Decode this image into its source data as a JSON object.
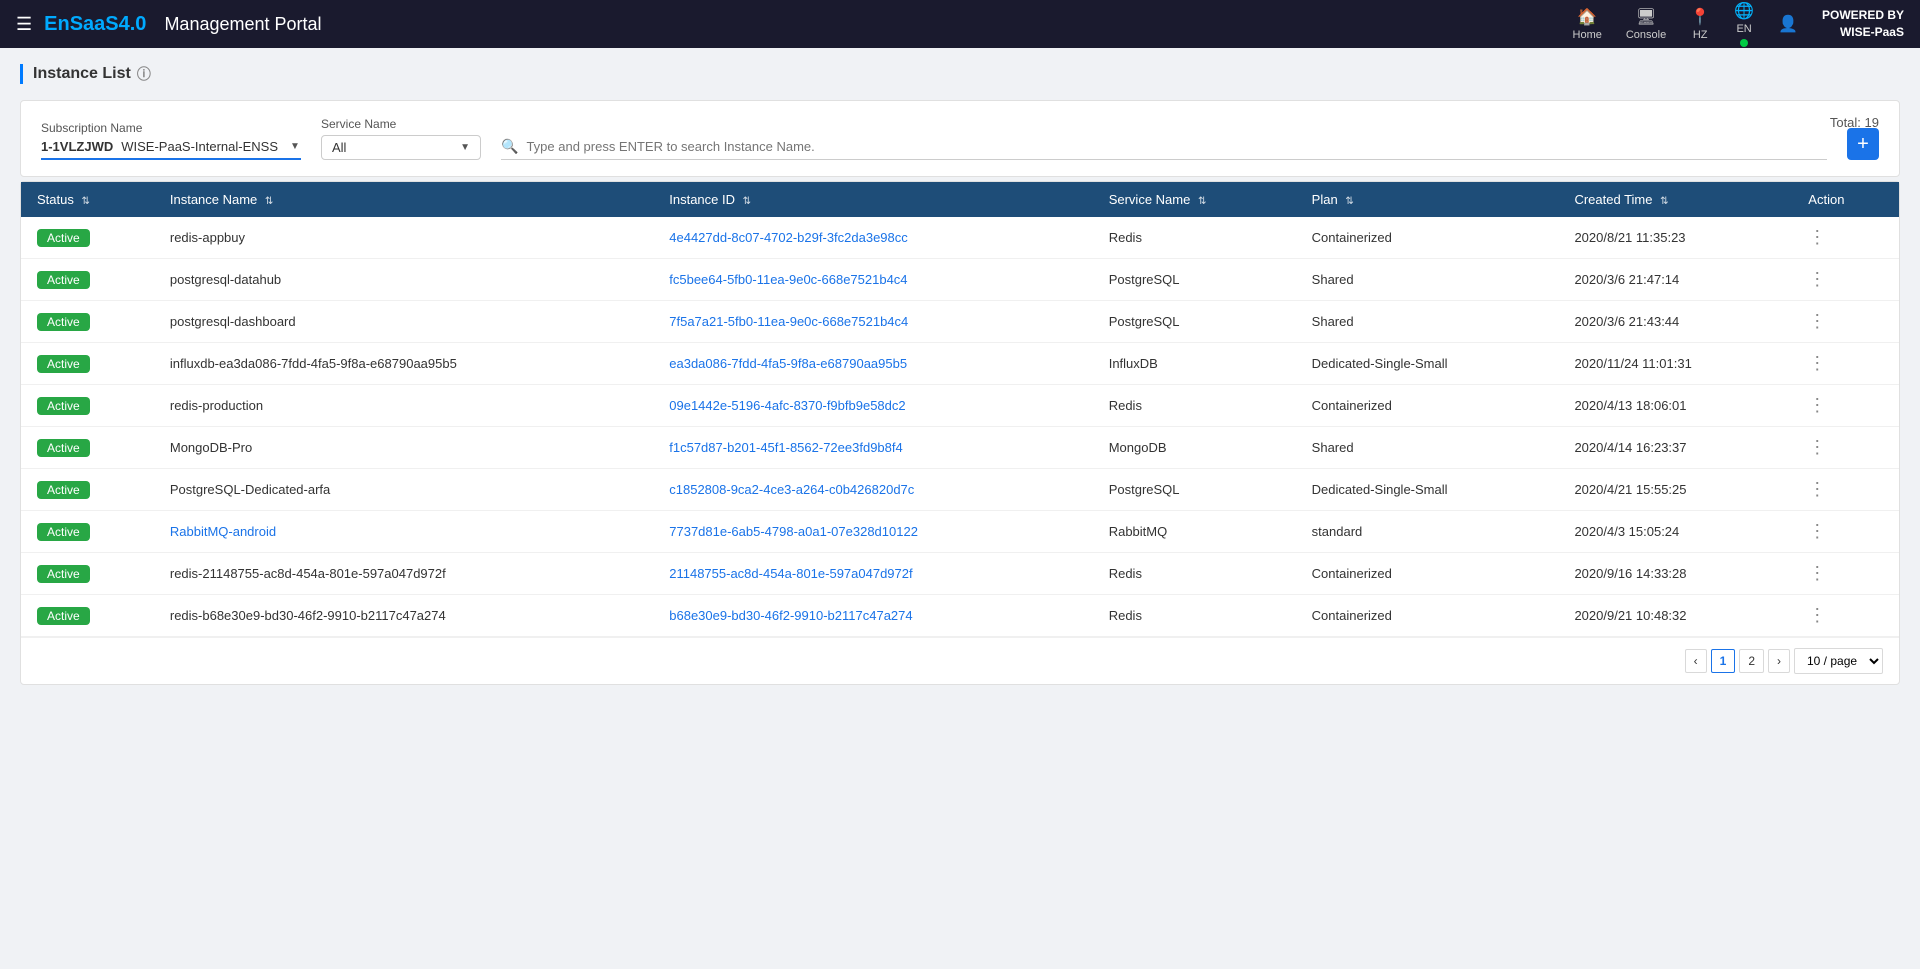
{
  "header": {
    "menu_icon": "☰",
    "brand": "EnSaaS4.0",
    "portal_title": "Management Portal",
    "nav_items": [
      {
        "icon": "🏠",
        "label": "Home"
      },
      {
        "icon": "🖥",
        "label": "Console"
      },
      {
        "icon": "📍",
        "label": "HZ"
      },
      {
        "icon": "🌐",
        "label": "EN"
      },
      {
        "icon": "👤",
        "label": ""
      }
    ],
    "powered_by_label": "POWERED BY",
    "powered_by_brand": "WISE-PaaS"
  },
  "page": {
    "title": "Instance List",
    "info_icon": "ⓘ"
  },
  "filter": {
    "subscription_label": "Subscription Name",
    "subscription_id": "1-1VLZJWD",
    "subscription_name": "WISE-PaaS-Internal-ENSS",
    "service_label": "Service Name",
    "service_value": "All",
    "search_placeholder": "Type and press ENTER to search Instance Name.",
    "total_label": "Total: 19",
    "add_button": "+"
  },
  "table": {
    "columns": [
      "Status",
      "Instance Name",
      "Instance ID",
      "Service Name",
      "Plan",
      "Created Time",
      "Action"
    ],
    "rows": [
      {
        "status": "Active",
        "instance_name": "redis-appbuy",
        "instance_id": "4e4427dd-8c07-4702-b29f-3fc2da3e98cc",
        "service_name": "Redis",
        "plan": "Containerized",
        "created_time": "2020/8/21 11:35:23",
        "name_is_link": false
      },
      {
        "status": "Active",
        "instance_name": "postgresql-datahub",
        "instance_id": "fc5bee64-5fb0-11ea-9e0c-668e7521b4c4",
        "service_name": "PostgreSQL",
        "plan": "Shared",
        "created_time": "2020/3/6 21:47:14",
        "name_is_link": false
      },
      {
        "status": "Active",
        "instance_name": "postgresql-dashboard",
        "instance_id": "7f5a7a21-5fb0-11ea-9e0c-668e7521b4c4",
        "service_name": "PostgreSQL",
        "plan": "Shared",
        "created_time": "2020/3/6 21:43:44",
        "name_is_link": false
      },
      {
        "status": "Active",
        "instance_name": "influxdb-ea3da086-7fdd-4fa5-9f8a-e68790aa95b5",
        "instance_id": "ea3da086-7fdd-4fa5-9f8a-e68790aa95b5",
        "service_name": "InfluxDB",
        "plan": "Dedicated-Single-Small",
        "created_time": "2020/11/24 11:01:31",
        "name_is_link": false
      },
      {
        "status": "Active",
        "instance_name": "redis-production",
        "instance_id": "09e1442e-5196-4afc-8370-f9bfb9e58dc2",
        "service_name": "Redis",
        "plan": "Containerized",
        "created_time": "2020/4/13 18:06:01",
        "name_is_link": false
      },
      {
        "status": "Active",
        "instance_name": "MongoDB-Pro",
        "instance_id": "f1c57d87-b201-45f1-8562-72ee3fd9b8f4",
        "service_name": "MongoDB",
        "plan": "Shared",
        "created_time": "2020/4/14 16:23:37",
        "name_is_link": false
      },
      {
        "status": "Active",
        "instance_name": "PostgreSQL-Dedicated-arfa",
        "instance_id": "c1852808-9ca2-4ce3-a264-c0b426820d7c",
        "service_name": "PostgreSQL",
        "plan": "Dedicated-Single-Small",
        "created_time": "2020/4/21 15:55:25",
        "name_is_link": false
      },
      {
        "status": "Active",
        "instance_name": "RabbitMQ-android",
        "instance_id": "7737d81e-6ab5-4798-a0a1-07e328d10122",
        "service_name": "RabbitMQ",
        "plan": "standard",
        "created_time": "2020/4/3 15:05:24",
        "name_is_link": true
      },
      {
        "status": "Active",
        "instance_name": "redis-21148755-ac8d-454a-801e-597a047d972f",
        "instance_id": "21148755-ac8d-454a-801e-597a047d972f",
        "service_name": "Redis",
        "plan": "Containerized",
        "created_time": "2020/9/16 14:33:28",
        "name_is_link": false
      },
      {
        "status": "Active",
        "instance_name": "redis-b68e30e9-bd30-46f2-9910-b2117c47a274",
        "instance_id": "b68e30e9-bd30-46f2-9910-b2117c47a274",
        "service_name": "Redis",
        "plan": "Containerized",
        "created_time": "2020/9/21 10:48:32",
        "name_is_link": false
      }
    ]
  },
  "pagination": {
    "prev_label": "‹",
    "next_label": "›",
    "current_page": "1",
    "next_page": "2",
    "page_size": "10 / page"
  }
}
